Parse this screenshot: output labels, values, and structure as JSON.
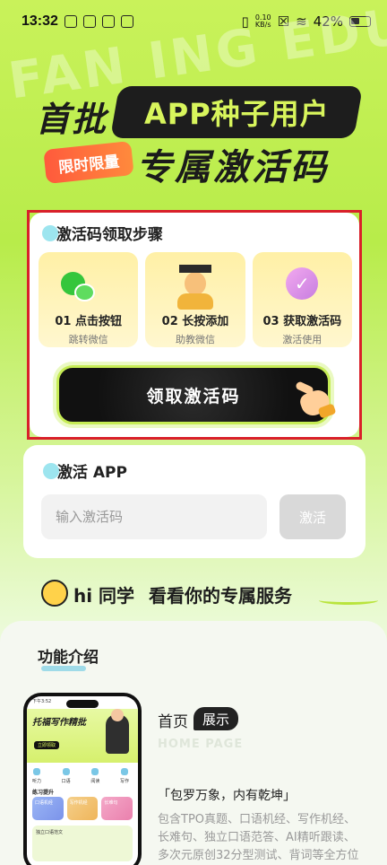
{
  "status_bar": {
    "time": "13:32",
    "net_speed_value": "0.10",
    "net_speed_unit": "KB/s",
    "battery": "42%"
  },
  "watermark": "FAN  ING EDU",
  "hero": {
    "prefix": "首批",
    "pill": "APP种子用户",
    "badge": "限时限量",
    "subtitle": "专属激活码"
  },
  "steps_card": {
    "title": "激活码领取步骤",
    "steps": [
      {
        "label": "01 点击按钮",
        "sub": "跳转微信",
        "icon": "wechat-icon"
      },
      {
        "label": "02 长按添加",
        "sub": "助教微信",
        "icon": "graduate-icon"
      },
      {
        "label": "03 获取激活码",
        "sub": "激活使用",
        "icon": "check-badge-icon"
      }
    ],
    "claim_button": "领取激活码"
  },
  "activate_card": {
    "title": "激活 APP",
    "input_placeholder": "输入激活码",
    "button": "激活"
  },
  "hi_line": {
    "greeting": "hi 同学",
    "tagline": "看看你的专属服务"
  },
  "features": {
    "title": "功能介绍",
    "phone_mock": {
      "status_time": "下午3:52",
      "banner_title": "托福写作精批",
      "banner_tag": "立即领取",
      "icons": [
        "听力",
        "口语",
        "阅读",
        "写作"
      ],
      "section": "练习提升",
      "tiles": [
        "口语机经",
        "写作机经",
        "长难句"
      ],
      "bottom": "独立口语范文"
    },
    "home": {
      "title": "首页",
      "chip": "展示",
      "en": "HOME PAGE",
      "quote": "「包罗万象，内有乾坤」",
      "desc": "包含TPO真题、口语机经、写作机经、长难句、独立口语范答、AI精听跟读、多次元原创32分型测试、背词等全方位学习"
    }
  },
  "colors": {
    "accent_green": "#c6ec55",
    "frame_red": "#d9202a",
    "badge_orange": "#ff6a3c"
  }
}
